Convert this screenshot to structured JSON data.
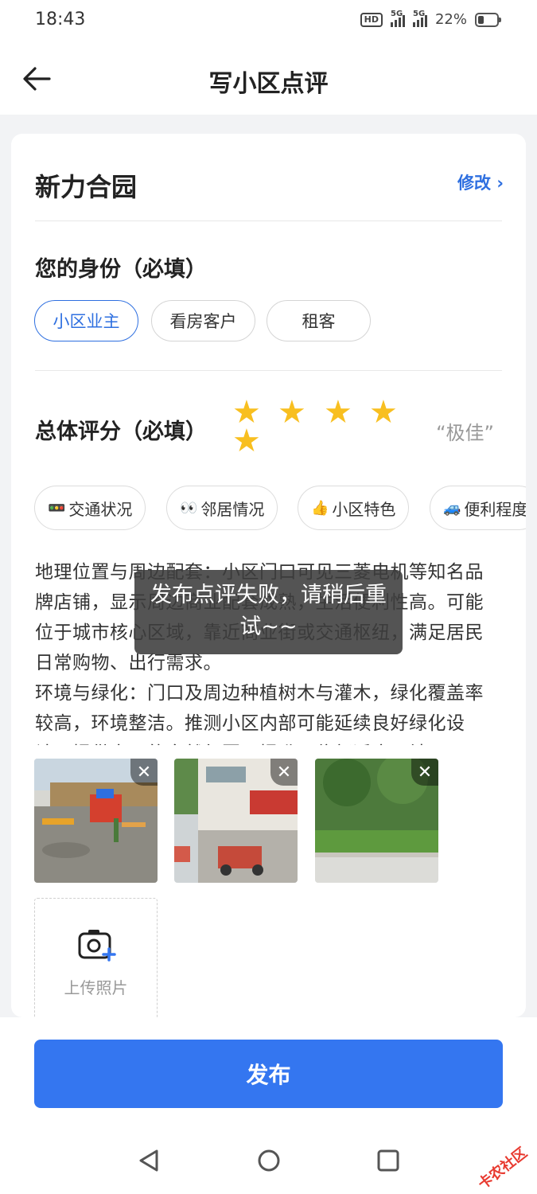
{
  "status_bar": {
    "time": "18:43",
    "network_1": "5G",
    "network_2": "5G",
    "battery": "22%"
  },
  "header": {
    "title": "写小区点评"
  },
  "community": {
    "name": "新力合园",
    "edit_label": "修改"
  },
  "identity": {
    "title": "您的身份（必填）",
    "options": [
      "小区业主",
      "看房客户",
      "租客"
    ],
    "selected": "小区业主"
  },
  "rating": {
    "title": "总体评分（必填）",
    "value_stars": 5,
    "text": "“极佳”"
  },
  "tags": [
    {
      "icon": "🚥",
      "label": "交通状况"
    },
    {
      "icon": "👀",
      "label": "邻居情况"
    },
    {
      "icon": "👍",
      "label": "小区特色"
    },
    {
      "icon": "🚙",
      "label": "便利程度"
    }
  ],
  "review": {
    "line1": "地理位置与周边配套：小区门口可见三菱电机等知名品牌店铺，显示周边商业配套成熟，生活便利性高。可能位于城市核心区域，靠近商业街或交通枢纽，满足居民日常购物、出行需求。",
    "line2": "环境与绿化：门口及周边种植树木与灌木，绿化覆盖率较高，环境整洁。推测小区内部可能延续良好绿化设计，提供宜居的自然氛围，提升居住舒适度。社区"
  },
  "photos": {
    "close_label": "✕",
    "upload_label": "上传照片"
  },
  "publish": {
    "label": "发布"
  },
  "toast": {
    "message": "发布点评失败，请稍后重试~~"
  },
  "watermark": {
    "text": "卡农社区"
  }
}
